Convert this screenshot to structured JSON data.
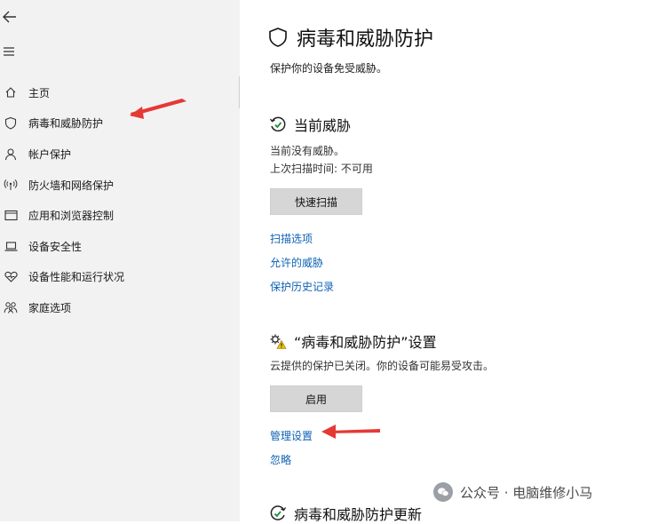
{
  "sidebar": {
    "back_icon": "back-arrow-icon",
    "menu_icon": "hamburger-icon",
    "items": [
      {
        "label": "主页",
        "icon": "home-icon"
      },
      {
        "label": "病毒和威胁防护",
        "icon": "shield-icon"
      },
      {
        "label": "帐户保护",
        "icon": "person-icon"
      },
      {
        "label": "防火墙和网络保护",
        "icon": "wireless-icon"
      },
      {
        "label": "应用和浏览器控制",
        "icon": "app-window-icon"
      },
      {
        "label": "设备安全性",
        "icon": "laptop-icon"
      },
      {
        "label": "设备性能和运行状况",
        "icon": "heart-icon"
      },
      {
        "label": "家庭选项",
        "icon": "family-icon"
      }
    ]
  },
  "page": {
    "title": "病毒和威胁防护",
    "subtitle": "保护你的设备免受威胁。"
  },
  "current_threats": {
    "title": "当前威胁",
    "status": "当前没有威胁。",
    "last_scan": "上次扫描时间: 不可用",
    "quick_scan_button": "快速扫描",
    "links": [
      "扫描选项",
      "允许的威胁",
      "保护历史记录"
    ]
  },
  "settings": {
    "title": "“病毒和威胁防护”设置",
    "warning": "云提供的保护已关闭。你的设备可能易受攻击。",
    "enable_button": "启用",
    "manage_link": "管理设置",
    "ignore_link": "忽略"
  },
  "updates": {
    "title": "病毒和威胁防护更新"
  },
  "watermark": {
    "text": "公众号 · 电脑维修小马"
  },
  "colors": {
    "sidebar_bg": "#f2f2f2",
    "link": "#0f62b5",
    "button_bg": "#d6d6d6",
    "annotation_arrow": "#e53935"
  }
}
